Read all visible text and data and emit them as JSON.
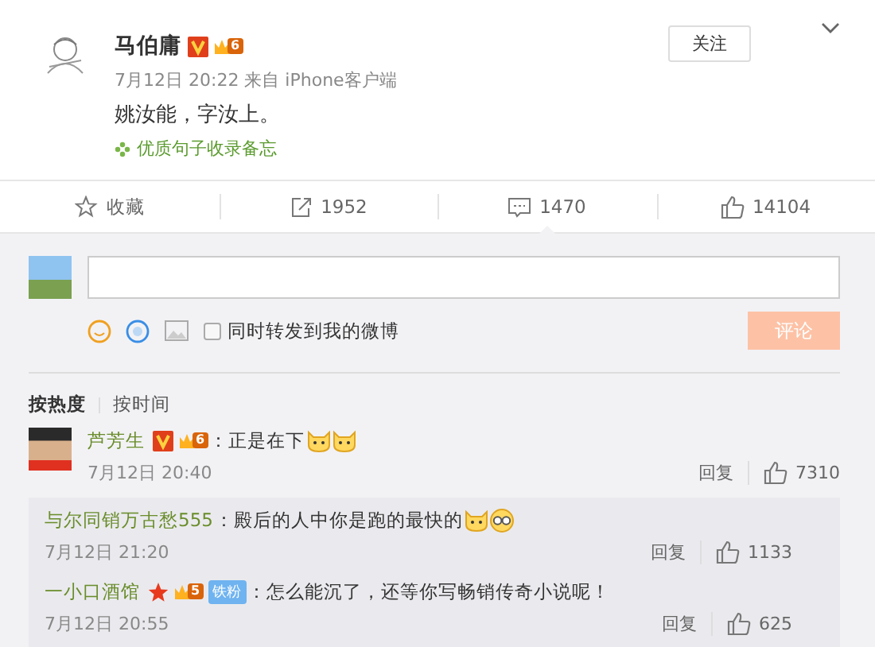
{
  "post": {
    "user": "马伯庸",
    "badges": [
      {
        "kind": "verified"
      },
      {
        "kind": "level",
        "text": "6"
      }
    ],
    "follow_label": "关注",
    "time": "7月12日 20:22 来自 iPhone客户端",
    "text": "姚汝能，字汝上。",
    "tag": "优质句子收录备忘"
  },
  "actions": [
    {
      "kind": "star",
      "label": "收藏",
      "selected": false
    },
    {
      "kind": "forward",
      "label": "1952",
      "selected": false
    },
    {
      "kind": "comment",
      "label": "1470",
      "selected": true
    },
    {
      "kind": "like",
      "label": "14104",
      "selected": false
    }
  ],
  "composer": {
    "share_label": "同时转发到我的微博",
    "share_checked": false,
    "submit_label": "评论",
    "submit_disabled": true
  },
  "sort_tabs": [
    {
      "label": "按热度",
      "selected": true
    },
    {
      "label": "按时间",
      "selected": false
    }
  ],
  "comments": [
    {
      "user": "芦芳生",
      "badges": [
        {
          "kind": "verified"
        },
        {
          "kind": "level",
          "text": "6"
        }
      ],
      "text": "：正是在下",
      "emojis": [
        {
          "kind": "cat"
        },
        {
          "kind": "cat"
        }
      ],
      "time": "7月12日 20:40",
      "reply_label": "回复",
      "likes": "7310",
      "replies": [
        {
          "user": "与尔同销万古愁555",
          "text": "：殿后的人中你是跑的最快的",
          "emojis": [
            {
              "kind": "cat"
            },
            {
              "kind": "glasses"
            }
          ],
          "time": "7月12日 21:20",
          "reply_label": "回复",
          "likes": "1133"
        },
        {
          "user": "一小口酒馆",
          "badges": [
            {
              "kind": "star"
            },
            {
              "kind": "level",
              "text": "5"
            },
            {
              "kind": "fan",
              "text": "铁粉"
            }
          ],
          "text": "：怎么能沉了，还等你写畅销传奇小说呢！",
          "time": "7月12日 20:55",
          "reply_label": "回复",
          "likes": "625"
        }
      ]
    }
  ]
}
